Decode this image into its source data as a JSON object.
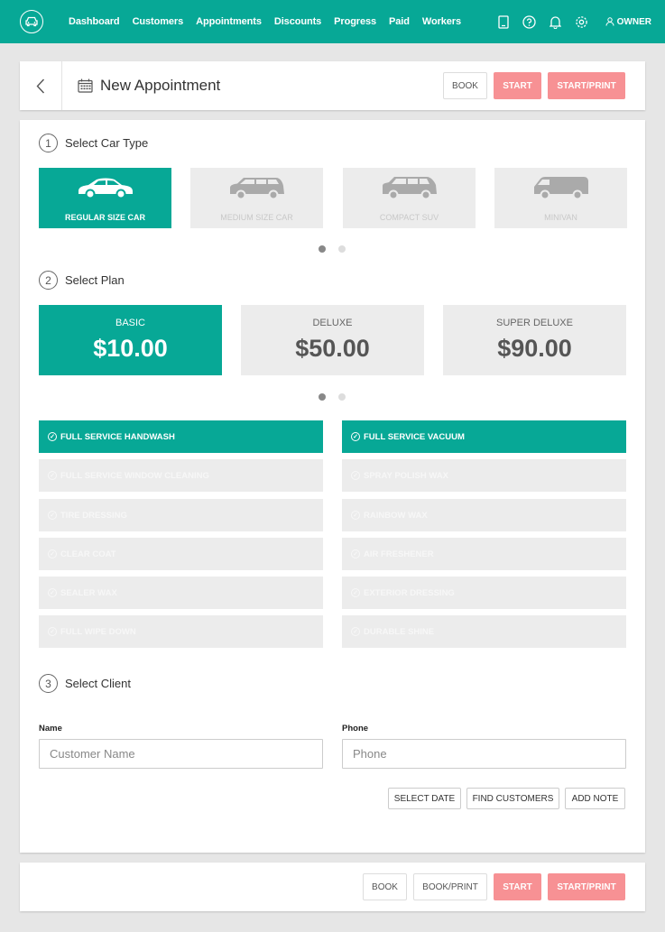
{
  "nav": {
    "items": [
      "Dashboard",
      "Customers",
      "Appointments",
      "Discounts",
      "Progress",
      "Paid",
      "Workers"
    ],
    "user": "OWNER",
    "icons": [
      "tablet-icon",
      "help-icon",
      "bell-icon",
      "settings-icon",
      "user-icon"
    ]
  },
  "header": {
    "title": "New Appointment",
    "book": "BOOK",
    "start": "START",
    "start_print": "START/PRINT"
  },
  "step1": {
    "num": "1",
    "label": "Select Car Type"
  },
  "cars": [
    {
      "label": "REGULAR SIZE CAR",
      "selected": true
    },
    {
      "label": "MEDIUM SIZE CAR",
      "selected": false
    },
    {
      "label": "COMPACT SUV",
      "selected": false
    },
    {
      "label": "MINIVAN",
      "selected": false
    }
  ],
  "step2": {
    "num": "2",
    "label": "Select Plan"
  },
  "plans": [
    {
      "name": "BASIC",
      "price": "$10.00",
      "selected": true
    },
    {
      "name": "DELUXE",
      "price": "$50.00",
      "selected": false
    },
    {
      "name": "SUPER DELUXE",
      "price": "$90.00",
      "selected": false
    }
  ],
  "services_left": [
    {
      "label": "FULL SERVICE HANDWASH",
      "selected": true
    },
    {
      "label": "FULL SERVICE WINDOW CLEANING",
      "selected": false
    },
    {
      "label": "TIRE DRESSING",
      "selected": false
    },
    {
      "label": "CLEAR COAT",
      "selected": false
    },
    {
      "label": "SEALER WAX",
      "selected": false
    },
    {
      "label": "FULL WIPE DOWN",
      "selected": false
    }
  ],
  "services_right": [
    {
      "label": "FULL SERVICE VACUUM",
      "selected": true
    },
    {
      "label": "SPRAY POLISH WAX",
      "selected": false
    },
    {
      "label": "RAINBOW WAX",
      "selected": false
    },
    {
      "label": "AIR FRESHENER",
      "selected": false
    },
    {
      "label": "EXTERIOR DRESSING",
      "selected": false
    },
    {
      "label": "DURABLE SHINE",
      "selected": false
    }
  ],
  "step3": {
    "num": "3",
    "label": "Select Client"
  },
  "client": {
    "name_label": "Name",
    "name_placeholder": "Customer Name",
    "name_value": "",
    "phone_label": "Phone",
    "phone_placeholder": "Phone",
    "phone_value": "",
    "select_date": "SELECT DATE",
    "find_customers": "FIND CUSTOMERS",
    "add_note": "ADD NOTE"
  },
  "footer": {
    "book": "BOOK",
    "book_print": "BOOK/PRINT",
    "start": "START",
    "start_print": "START/PRINT"
  },
  "colors": {
    "accent": "#07a896",
    "pink": "#f79194",
    "inactive": "#ececec"
  }
}
